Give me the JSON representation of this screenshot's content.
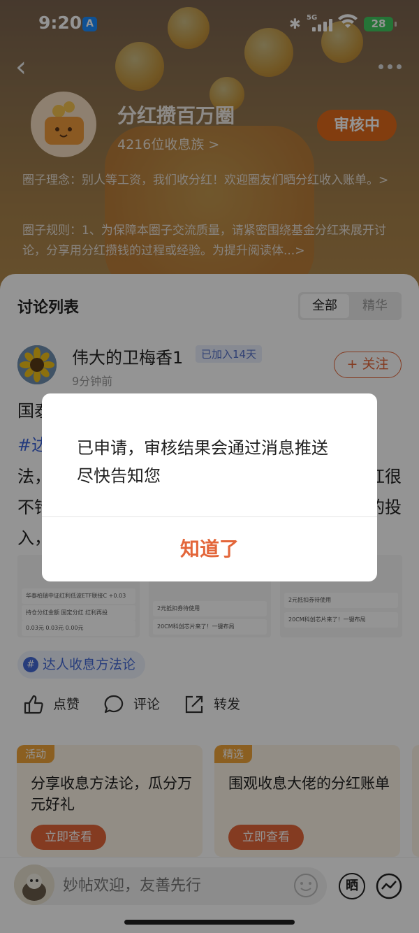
{
  "status_bar": {
    "time": "9:20",
    "network": "5G",
    "battery": "28"
  },
  "circle": {
    "title": "分红攒百万圈",
    "members": "4216位收息族 >",
    "status_badge": "审核中",
    "philosophy": "圈子理念：别人等工资，我们收分红！欢迎圈友们晒分红收入账单。>",
    "rules": "圈子规则：1、为保障本圈子交流质量，请紧密围绕基金分红来展开讨论，分享用分红攒钱的过程或经验。为提升阅读体...>"
  },
  "discussion": {
    "title": "讨论列表",
    "tabs": [
      {
        "label": "全部",
        "active": true
      },
      {
        "label": "精华",
        "active": false
      }
    ]
  },
  "post": {
    "author": "伟大的卫梅香1",
    "joined_badge": "已加入14天",
    "time": "9分钟前",
    "follow_label": "+ 关注",
    "line1": "国泰",
    "hashtag_prefix": "#达",
    "line3_left": "法，",
    "line3_right": "红很",
    "line4_left": "不错",
    "line4_right": "的投",
    "line5_left": "入，",
    "thumbnails": [
      {
        "rows": [
          "华泰柏瑞中证红利低波ETF联接C  +0.03",
          "持仓分红金额  固定分红  红利再投",
          "0.03元    0.03元    0.00元"
        ]
      },
      {
        "rows": [
          "2元抵扣券待使用",
          "20CM科创芯片来了！一键布局"
        ]
      },
      {
        "rows": [
          "2元抵扣券待使用",
          "20CM科创芯片来了！一键布局"
        ]
      }
    ],
    "topic_tag": "达人收息方法论",
    "actions": {
      "like": "点赞",
      "comment": "评论",
      "share": "转发"
    }
  },
  "cards": [
    {
      "tag": "活动",
      "title": "分享收息方法论，瓜分万元好礼",
      "button": "立即查看"
    },
    {
      "tag": "精选",
      "title": "围观收息大佬的分红账单",
      "button": "立即查看"
    }
  ],
  "bottom_bar": {
    "placeholder": "妙帖欢迎，友善先行",
    "shai_label": "晒"
  },
  "dialog": {
    "message": "已申请，审核结果会通过消息推送尽快告知您",
    "confirm": "知道了"
  },
  "colors": {
    "accent": "#e3663a",
    "link": "#3c63d8",
    "badge_bg": "#e06a1a"
  }
}
